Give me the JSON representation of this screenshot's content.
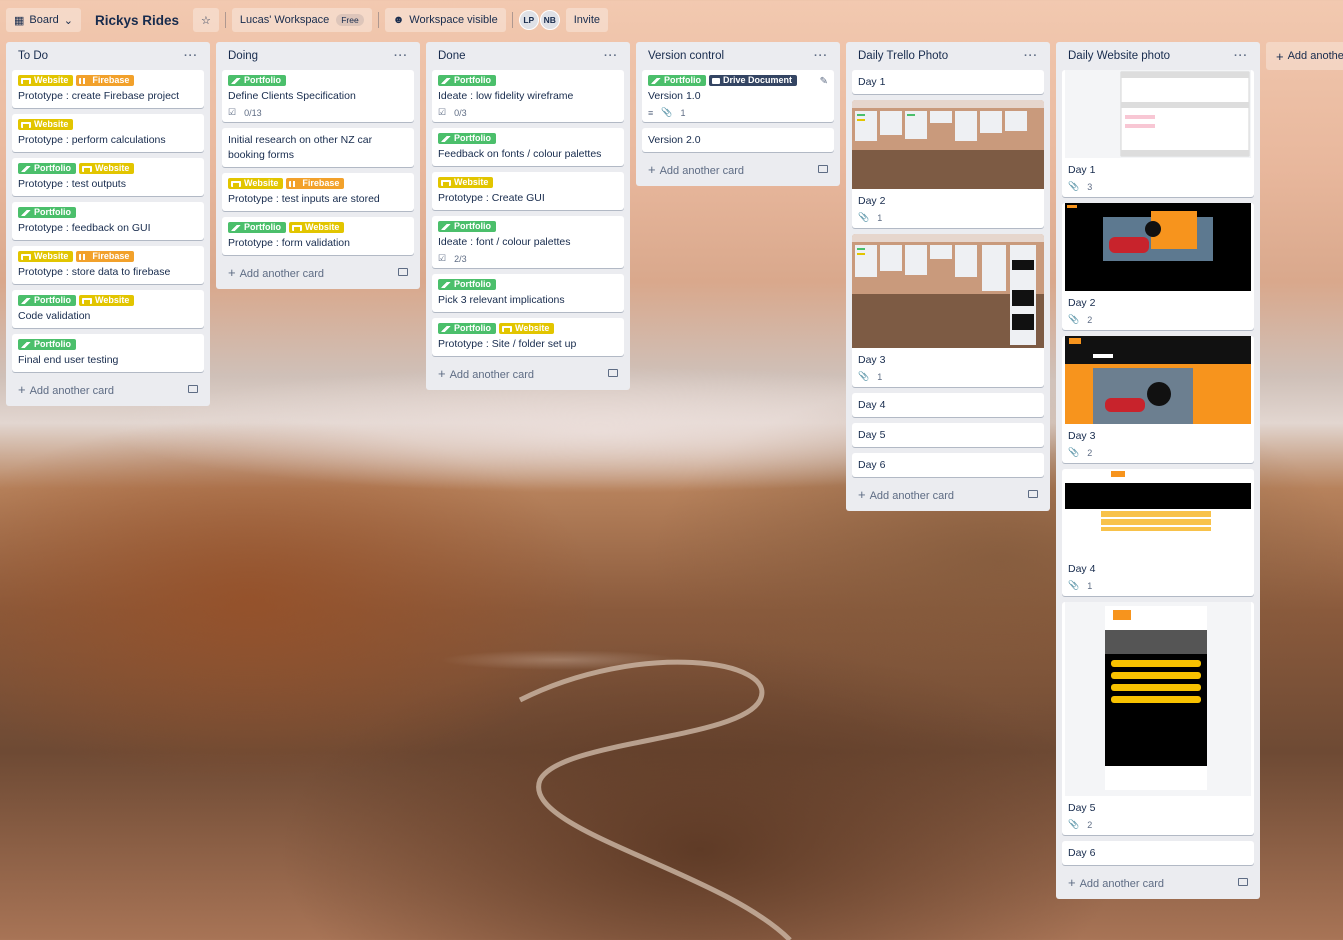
{
  "header": {
    "board_view": "Board",
    "board_title": "Rickys Rides",
    "workspace": "Lucas' Workspace",
    "workspace_badge": "Free",
    "visibility": "Workspace visible",
    "members": [
      "LP",
      "NB"
    ],
    "invite": "Invite"
  },
  "add_list_label": "Add another list",
  "add_card_label": "Add another card",
  "labels": {
    "website": "Website",
    "firebase": "Firebase",
    "portfolio": "Portfolio",
    "drive": "Drive Document"
  },
  "lists": {
    "todo": {
      "title": "To Do",
      "cards": [
        "Prototype : create Firebase project",
        "Prototype : perform calculations",
        "Prototype : test outputs",
        "Prototype : feedback on GUI",
        "Prototype : store data to firebase",
        "Code validation",
        "Final end user testing"
      ]
    },
    "doing": {
      "title": "Doing",
      "cards": [
        "Define Clients Specification",
        "Initial research on other NZ car booking forms",
        "Prototype : test inputs are stored",
        "Prototype : form validation"
      ],
      "checklist_0": "0/13"
    },
    "done": {
      "title": "Done",
      "cards": [
        "Ideate : low fidelity wireframe",
        "Feedback on fonts / colour palettes",
        "Prototype : Create GUI",
        "Ideate : font / colour palettes",
        "Pick 3 relevant implications",
        "Prototype : Site / folder set up"
      ],
      "checklist_0": "0/3",
      "checklist_3": "2/3"
    },
    "version": {
      "title": "Version control",
      "cards": [
        "Version 1.0",
        "Version 2.0"
      ],
      "attach_0": "1"
    },
    "trello": {
      "title": "Daily Trello Photo",
      "cards": [
        "Day 1",
        "Day 2",
        "Day 3",
        "Day 4",
        "Day 5",
        "Day 6"
      ],
      "attach_1": "1",
      "attach_2": "1"
    },
    "website": {
      "title": "Daily Website photo",
      "cards": [
        "Day 1",
        "Day 2",
        "Day 3",
        "Day 4",
        "Day 5",
        "Day 6"
      ],
      "attach": [
        "3",
        "2",
        "2",
        "1",
        "2"
      ]
    }
  },
  "colors": {
    "green": "#4bbf6b",
    "yellow": "#e2c500",
    "orange": "#f2a12b",
    "navy": "#344563"
  }
}
